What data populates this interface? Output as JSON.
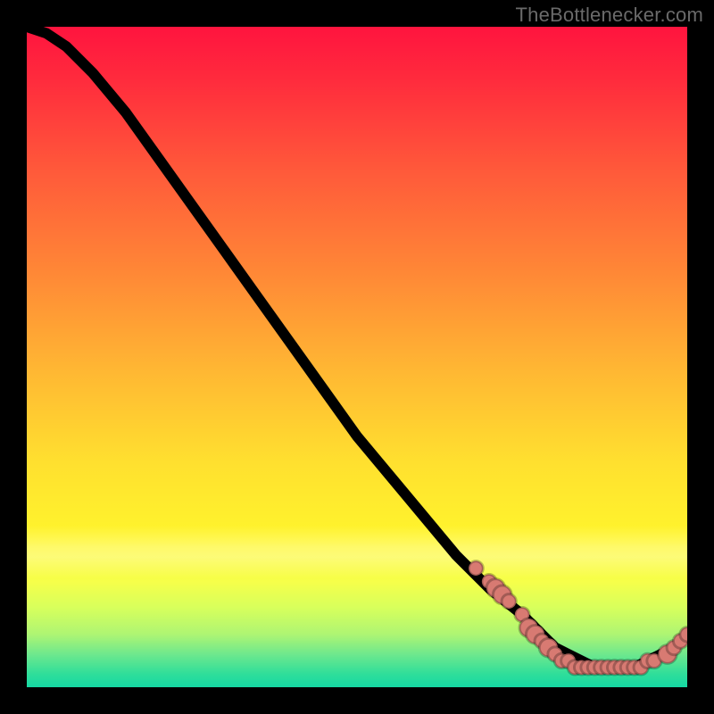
{
  "watermark": "TheBottlenecker.com",
  "colors": {
    "dot": "#d87a72",
    "curve": "#000000",
    "gradient_top": "#ff143e",
    "gradient_bottom": "#15d8a3"
  },
  "chart_data": {
    "type": "line",
    "title": "",
    "xlabel": "",
    "ylabel": "",
    "xlim": [
      0,
      100
    ],
    "ylim": [
      0,
      100
    ],
    "grid": false,
    "legend": false,
    "series": [
      {
        "name": "bottleneck-curve",
        "x": [
          0,
          3,
          6,
          10,
          15,
          20,
          25,
          30,
          35,
          40,
          45,
          50,
          55,
          60,
          65,
          70,
          75,
          78,
          80,
          82,
          84,
          86,
          88,
          90,
          92,
          94,
          96,
          98,
          100
        ],
        "values": [
          100,
          99,
          97,
          93,
          87,
          80,
          73,
          66,
          59,
          52,
          45,
          38,
          32,
          26,
          20,
          15,
          11,
          8,
          6,
          5,
          4,
          3,
          3,
          3,
          3,
          4,
          5,
          6,
          8
        ]
      }
    ],
    "scatter_points": {
      "name": "scatter-dots",
      "points": [
        {
          "x": 68,
          "y": 18,
          "r": 1.1
        },
        {
          "x": 70,
          "y": 16,
          "r": 1.1
        },
        {
          "x": 71,
          "y": 15,
          "r": 1.4
        },
        {
          "x": 72,
          "y": 14,
          "r": 1.4
        },
        {
          "x": 73,
          "y": 13,
          "r": 1.1
        },
        {
          "x": 75,
          "y": 11,
          "r": 1.1
        },
        {
          "x": 76,
          "y": 9,
          "r": 1.4
        },
        {
          "x": 77,
          "y": 8,
          "r": 1.4
        },
        {
          "x": 78,
          "y": 7,
          "r": 1.1
        },
        {
          "x": 79,
          "y": 6,
          "r": 1.4
        },
        {
          "x": 80,
          "y": 5,
          "r": 1.1
        },
        {
          "x": 81,
          "y": 4,
          "r": 1.1
        },
        {
          "x": 82,
          "y": 4,
          "r": 1.1
        },
        {
          "x": 83,
          "y": 3,
          "r": 1.1
        },
        {
          "x": 84,
          "y": 3,
          "r": 1.1
        },
        {
          "x": 85,
          "y": 3,
          "r": 1.1
        },
        {
          "x": 86,
          "y": 3,
          "r": 1.1
        },
        {
          "x": 87,
          "y": 3,
          "r": 1.1
        },
        {
          "x": 88,
          "y": 3,
          "r": 1.1
        },
        {
          "x": 89,
          "y": 3,
          "r": 1.1
        },
        {
          "x": 90,
          "y": 3,
          "r": 1.1
        },
        {
          "x": 91,
          "y": 3,
          "r": 1.1
        },
        {
          "x": 92,
          "y": 3,
          "r": 1.1
        },
        {
          "x": 93,
          "y": 3,
          "r": 1.1
        },
        {
          "x": 94,
          "y": 4,
          "r": 1.1
        },
        {
          "x": 95,
          "y": 4,
          "r": 1.1
        },
        {
          "x": 97,
          "y": 5,
          "r": 1.4
        },
        {
          "x": 98,
          "y": 6,
          "r": 1.1
        },
        {
          "x": 99,
          "y": 7,
          "r": 1.1
        },
        {
          "x": 100,
          "y": 8,
          "r": 1.1
        }
      ]
    }
  }
}
